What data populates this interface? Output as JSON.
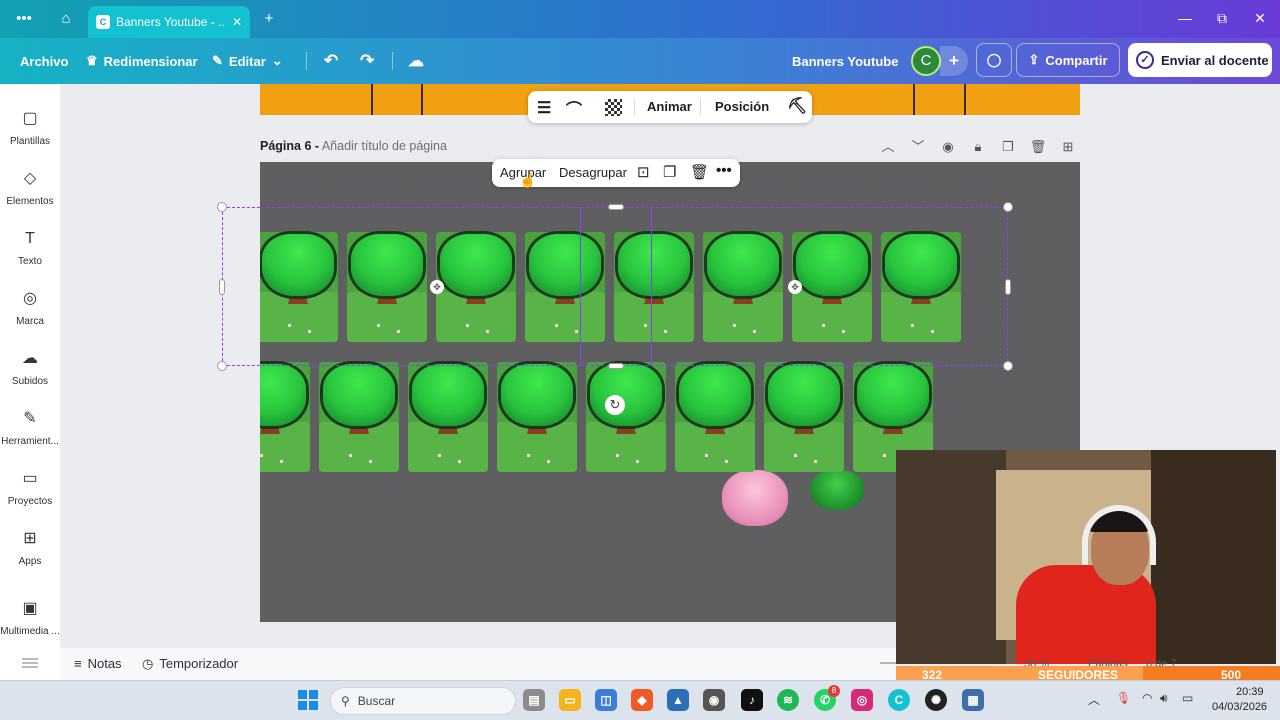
{
  "browser": {
    "tab_title": "Banners Youtube - ...",
    "tab_favicon": "canva-icon",
    "new_tab": "+",
    "minimize": "—",
    "restore": "⧉",
    "close": "✕"
  },
  "toolbar": {
    "file_label": "Archivo",
    "resize_label": "Redimensionar",
    "edit_label": "Editar",
    "project_title": "Banners Youtube",
    "avatar_initial": "C",
    "share_label": "Compartir",
    "send_label": "Enviar al docente"
  },
  "sidebar": {
    "items": [
      {
        "label": "Plantillas",
        "icon": "▢"
      },
      {
        "label": "Elementos",
        "icon": "◇"
      },
      {
        "label": "Texto",
        "icon": "T"
      },
      {
        "label": "Marca",
        "icon": "◎"
      },
      {
        "label": "Subidos",
        "icon": "☁"
      },
      {
        "label": "Herramient...",
        "icon": "✎"
      },
      {
        "label": "Proyectos",
        "icon": "▭"
      },
      {
        "label": "Apps",
        "icon": "⊞"
      },
      {
        "label": "Multimedia ...",
        "icon": "▣"
      }
    ]
  },
  "element_toolbar": {
    "animate_label": "Animar",
    "position_label": "Posición"
  },
  "page": {
    "title_prefix": "Página 6 -",
    "title_placeholder": "Añadir título de página"
  },
  "group_toolbar": {
    "group_label": "Agrupar",
    "ungroup_label": "Desagrupar"
  },
  "bottom_bar": {
    "notes_label": "Notas",
    "timer_label": "Temporizador",
    "zoom": "38 %",
    "pages_label": "Páginas",
    "page_counter": "6 de 7"
  },
  "stream": {
    "current": "322",
    "label": "SEGUIDORES",
    "goal": "500"
  },
  "taskbar": {
    "search_placeholder": "Buscar",
    "badge_whatsapp": "8",
    "time": "20:39",
    "date": "04/03/2026"
  },
  "colors": {
    "accent_purple": "#8b3dff",
    "canva_teal": "#13c1d0",
    "stream_orange": "#f57c1f"
  }
}
